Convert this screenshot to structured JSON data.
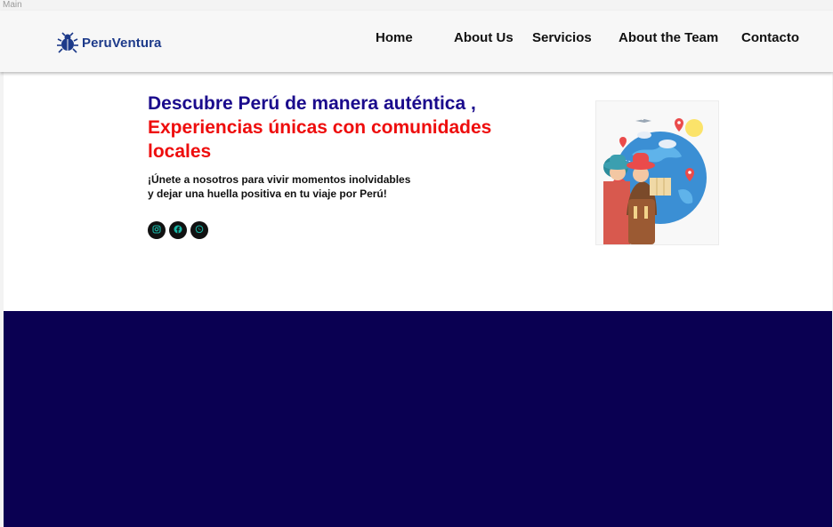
{
  "frame_label": "Main",
  "brand": {
    "name": "PeruVentura",
    "color": "#1d3a8a"
  },
  "nav": {
    "items": [
      {
        "label": "Home"
      },
      {
        "label": "About Us"
      },
      {
        "label": "Servicios"
      },
      {
        "label": "About the Team"
      },
      {
        "label": "Contacto"
      }
    ]
  },
  "hero": {
    "title_line1": "Descubre Perú de manera auténtica ,",
    "title_line2": "Experiencias únicas con comunidades",
    "title_line3": "locales",
    "subtitle_line1": "¡Únete a nosotros para vivir momentos inolvidables",
    "subtitle_line2": "y dejar una huella positiva en tu viaje por Perú!",
    "social_icons": [
      "instagram-icon",
      "facebook-icon",
      "whatsapp-icon"
    ],
    "icon_color": "#18b7a6",
    "title_color_primary": "#1a0a8c",
    "title_color_accent": "#ee0d0d"
  },
  "footer_section": {
    "background": "#0a0052"
  }
}
